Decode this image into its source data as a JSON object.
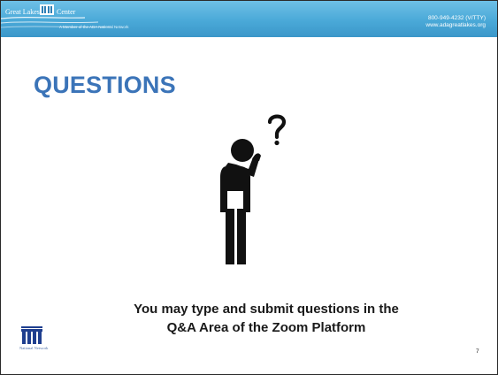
{
  "header": {
    "logo_left": "Great Lakes",
    "logo_right": "Center",
    "tagline": "A Member of the ADA National Network",
    "phone": "800-949-4232 (V/TTY)",
    "website": "www.adagreatlakes.org"
  },
  "slide": {
    "title": "QUESTIONS",
    "body_line_1": "You may type and submit questions in the",
    "body_line_2": "Q&A Area of the Zoom Platform",
    "page_number": "7"
  },
  "footer": {
    "logo_text": "National Network"
  },
  "colors": {
    "header_blue": "#4aa9d8",
    "title_blue": "#3b74b8",
    "figure": "#111111"
  },
  "icons": {
    "figure": "person-question-icon",
    "logo": "ada-logo-icon"
  }
}
